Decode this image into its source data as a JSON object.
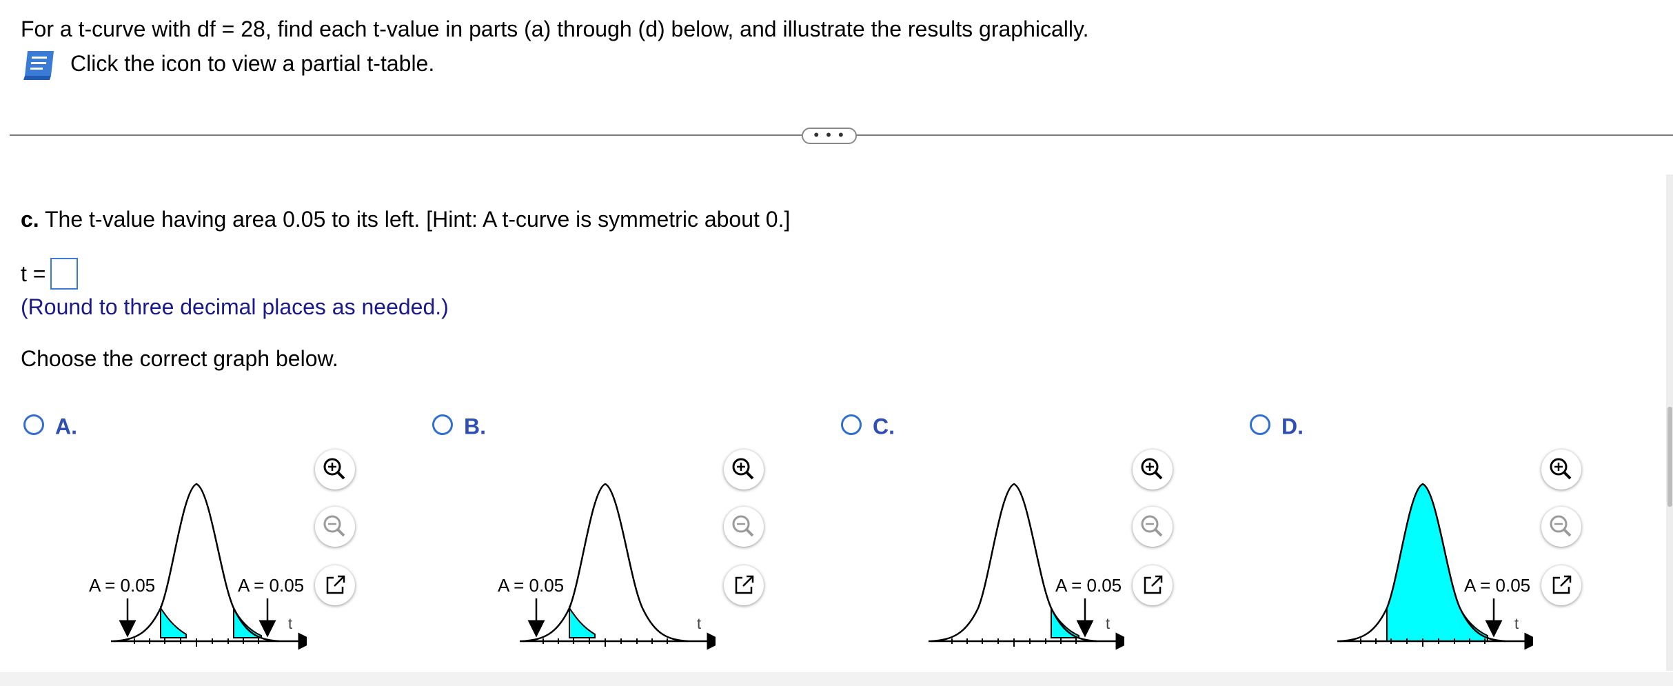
{
  "question": {
    "text": "For a t-curve with df = 28, find each t-value in parts (a) through (d) below, and illustrate the results graphically.",
    "table_link": "Click the icon to view a partial t-table."
  },
  "expand_button": "• • •",
  "part_c": {
    "label": "c.",
    "text": " The t-value having area 0.05 to its left. [Hint: A t-curve is symmetric about 0.]",
    "answer_label": "t =",
    "answer_value": "",
    "round_note": "(Round to three decimal places as needed.)"
  },
  "choose_text": "Choose the correct graph below.",
  "options": [
    {
      "letter": "A.",
      "left_label": "A = 0.05",
      "right_label": "A = 0.05",
      "axis_label": "t"
    },
    {
      "letter": "B.",
      "left_label": "A = 0.05",
      "axis_label": "t"
    },
    {
      "letter": "C.",
      "right_label": "A = 0.05",
      "axis_label": "t"
    },
    {
      "letter": "D.",
      "right_label": "A = 0.05",
      "axis_label": "t"
    }
  ],
  "colors": {
    "shade": "#00ffff",
    "accent": "#2f6fd1",
    "note": "#1a1a8c"
  },
  "icons": [
    "book-icon",
    "zoom-in-icon",
    "zoom-out-icon",
    "popout-icon"
  ]
}
